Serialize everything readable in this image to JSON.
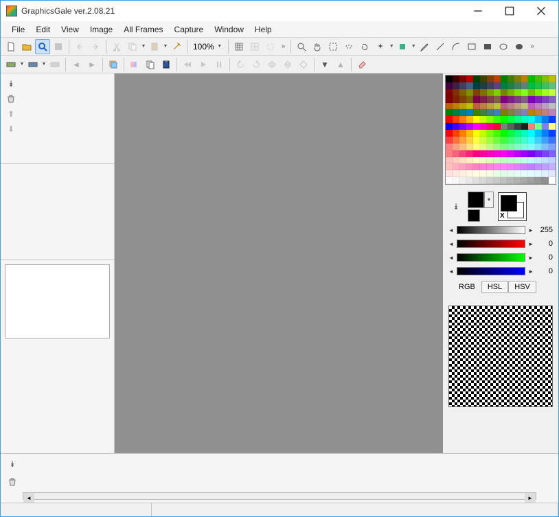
{
  "window": {
    "title": "GraphicsGale ver.2.08.21"
  },
  "menu": {
    "file": "File",
    "edit": "Edit",
    "view": "View",
    "image": "Image",
    "allframes": "All Frames",
    "capture": "Capture",
    "window": "Window",
    "help": "Help"
  },
  "toolbar1": {
    "zoom": "100%"
  },
  "sliders": {
    "gray": {
      "value": "255"
    },
    "r": {
      "value": "0"
    },
    "g": {
      "value": "0"
    },
    "b": {
      "value": "0"
    }
  },
  "colorspace": {
    "rgb": "RGB",
    "hsl": "HSL",
    "hsv": "HSV"
  },
  "palette_colors": [
    "#000000",
    "#400000",
    "#800000",
    "#bf0000",
    "#004000",
    "#404000",
    "#804000",
    "#bf4000",
    "#008000",
    "#408000",
    "#808000",
    "#bf8000",
    "#00bf00",
    "#40bf00",
    "#80bf00",
    "#bfbf00",
    "#400040",
    "#402040",
    "#404060",
    "#406080",
    "#004040",
    "#204040",
    "#404060",
    "#604080",
    "#008040",
    "#208040",
    "#408060",
    "#608080",
    "#00bf40",
    "#20bf40",
    "#40bf60",
    "#60bf80",
    "#800000",
    "#803000",
    "#806000",
    "#809000",
    "#804000",
    "#807000",
    "#80a000",
    "#80d000",
    "#808000",
    "#80b000",
    "#80e000",
    "#80ff20",
    "#80bf00",
    "#80ef00",
    "#a0ff20",
    "#c0ff40",
    "#7f0000",
    "#7f2000",
    "#7f4000",
    "#7f6000",
    "#7f0040",
    "#7f2040",
    "#7f4040",
    "#7f6040",
    "#7f0080",
    "#7f2080",
    "#7f4080",
    "#7f6080",
    "#7f00bf",
    "#7f20bf",
    "#7f40bf",
    "#7f60bf",
    "#bf5f00",
    "#bf7f00",
    "#bf9f00",
    "#bfbf00",
    "#bf5f40",
    "#bf7f40",
    "#bf9f40",
    "#bfbf40",
    "#bf5f80",
    "#bf7f80",
    "#bf9f80",
    "#bfbf80",
    "#bf5fbf",
    "#bf7fbf",
    "#bf9fbf",
    "#bfbfbf",
    "#008000",
    "#008040",
    "#008080",
    "#0080bf",
    "#408000",
    "#408040",
    "#408080",
    "#4080bf",
    "#808000",
    "#808040",
    "#808080",
    "#8080bf",
    "#bf8000",
    "#bf8040",
    "#bf8080",
    "#bf80bf",
    "#ff0000",
    "#ff4000",
    "#ff8000",
    "#ffbf00",
    "#ffff00",
    "#bfff00",
    "#80ff00",
    "#40ff00",
    "#00ff00",
    "#00ff40",
    "#00ff80",
    "#00ffbf",
    "#00ffff",
    "#00bfff",
    "#0080ff",
    "#0040ff",
    "#0000ff",
    "#4000ff",
    "#8000ff",
    "#bf00ff",
    "#ff00ff",
    "#ff00bf",
    "#ff0080",
    "#ff0040",
    "#7f7f7f",
    "#5f5f5f",
    "#3f3f3f",
    "#1f1f1f",
    "#ff7f7f",
    "#7fff7f",
    "#7f7fff",
    "#ffff7f",
    "#ff0000",
    "#ff4000",
    "#ff8000",
    "#ffc000",
    "#ffff00",
    "#c0ff00",
    "#80ff00",
    "#40ff00",
    "#00ff00",
    "#00ff40",
    "#00ff80",
    "#00ffc0",
    "#00ffff",
    "#00c0ff",
    "#0080ff",
    "#0040ff",
    "#ff4040",
    "#ff7040",
    "#ffa040",
    "#ffd040",
    "#ffff40",
    "#d0ff40",
    "#a0ff40",
    "#70ff40",
    "#40ff40",
    "#40ff70",
    "#40ffa0",
    "#40ffd0",
    "#40ffff",
    "#40d0ff",
    "#40a0ff",
    "#4070ff",
    "#ff8080",
    "#ffa080",
    "#ffc080",
    "#ffe080",
    "#ffff80",
    "#e0ff80",
    "#c0ff80",
    "#a0ff80",
    "#80ff80",
    "#80ffa0",
    "#80ffc0",
    "#80ffe0",
    "#80ffff",
    "#80e0ff",
    "#80c0ff",
    "#80a0ff",
    "#ff8080",
    "#ff6080",
    "#ff4080",
    "#ff2080",
    "#ff0080",
    "#ff00a0",
    "#ff00c0",
    "#ff00e0",
    "#ff00ff",
    "#e000ff",
    "#c000ff",
    "#a000ff",
    "#8000ff",
    "#8020ff",
    "#8040ff",
    "#8060ff",
    "#ffc0c0",
    "#ffd0c0",
    "#ffe0c0",
    "#fff0c0",
    "#ffffc0",
    "#f0ffc0",
    "#e0ffc0",
    "#d0ffc0",
    "#c0ffc0",
    "#c0ffd0",
    "#c0ffe0",
    "#c0fff0",
    "#c0ffff",
    "#c0f0ff",
    "#c0e0ff",
    "#c0d0ff",
    "#ffc0c0",
    "#ffb0c0",
    "#ffa0c0",
    "#ff90c0",
    "#ff80c0",
    "#ff80d0",
    "#ff80e0",
    "#ff80f0",
    "#ff80ff",
    "#f080ff",
    "#e080ff",
    "#d080ff",
    "#c080ff",
    "#c090ff",
    "#c0a0ff",
    "#c0b0ff",
    "#ffe0e0",
    "#ffe8e0",
    "#fff0e0",
    "#fff8e0",
    "#ffffe0",
    "#f8ffe0",
    "#f0ffe0",
    "#e8ffe0",
    "#e0ffe0",
    "#e0ffe8",
    "#e0fff0",
    "#e0fff8",
    "#e0ffff",
    "#e0f8ff",
    "#e0f0ff",
    "#e0e8ff",
    "#ffffff",
    "#f8f8f8",
    "#f0f0f0",
    "#e8e8e8",
    "#e0e0e0",
    "#d8d8d8",
    "#d0d0d0",
    "#c8c8c8",
    "#c0c0c0",
    "#b8b8b8",
    "#b0b0b0",
    "#a8a8a8",
    "#a0a0a0",
    "#989898",
    "#909090",
    "#ffffff"
  ]
}
